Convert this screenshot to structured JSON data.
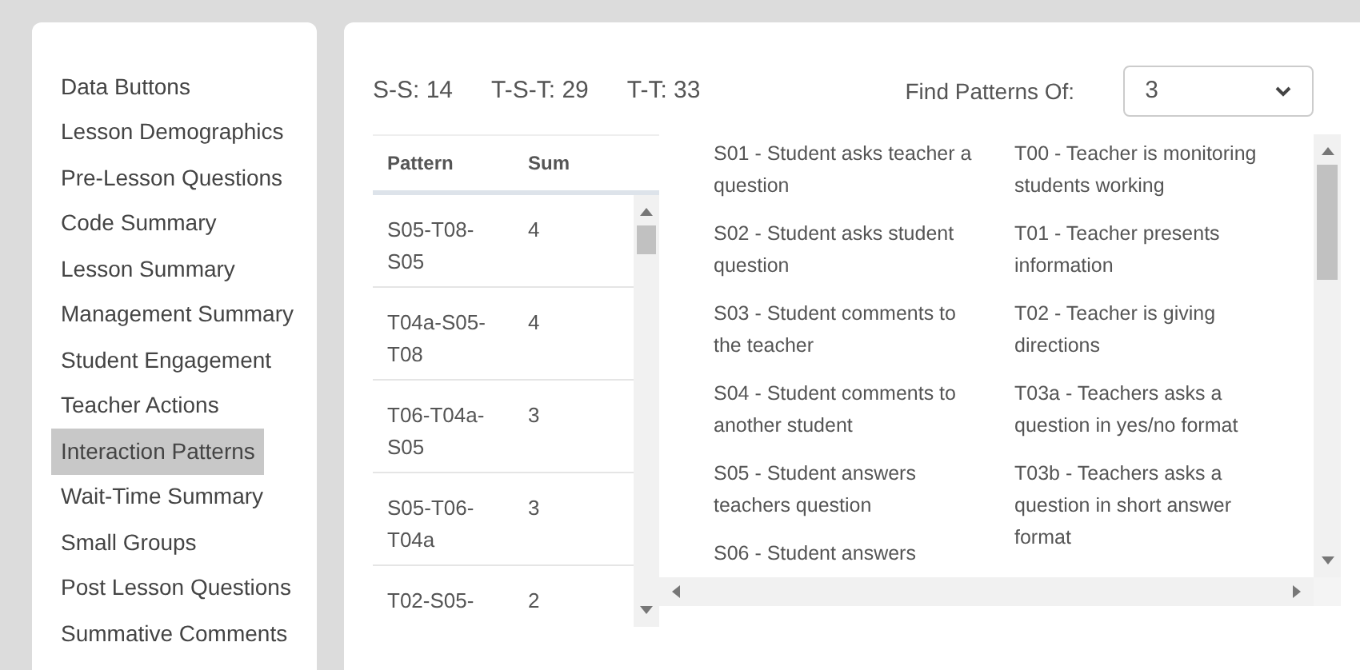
{
  "sidebar": {
    "items": [
      {
        "label": "Data Buttons",
        "selected": false
      },
      {
        "label": "Lesson Demographics",
        "selected": false
      },
      {
        "label": "Pre-Lesson Questions",
        "selected": false
      },
      {
        "label": "Code Summary",
        "selected": false
      },
      {
        "label": "Lesson Summary",
        "selected": false
      },
      {
        "label": "Management Summary",
        "selected": false
      },
      {
        "label": "Student Engagement",
        "selected": false
      },
      {
        "label": "Teacher Actions",
        "selected": false
      },
      {
        "label": "Interaction Patterns",
        "selected": true
      },
      {
        "label": "Wait-Time Summary",
        "selected": false
      },
      {
        "label": "Small Groups",
        "selected": false
      },
      {
        "label": "Post Lesson Questions",
        "selected": false
      },
      {
        "label": "Summative Comments",
        "selected": false
      }
    ]
  },
  "counts": [
    "S-S: 14",
    "T-S-T: 29",
    "T-T: 33"
  ],
  "find_patterns": {
    "label": "Find Patterns Of:",
    "value": "3"
  },
  "table": {
    "columns": [
      "Pattern",
      "Sum"
    ],
    "rows": [
      [
        "S05-T08-S05",
        "4"
      ],
      [
        "T04a-S05-T08",
        "4"
      ],
      [
        "T06-T04a-S05",
        "3"
      ],
      [
        "S05-T06-T04a",
        "3"
      ],
      [
        "T02-S05-",
        "2"
      ]
    ]
  },
  "legend": {
    "column_1": [
      "S01 - Student asks teacher a question",
      "S02 - Student asks student question",
      "S03 - Student comments to the teacher",
      "S04 - Student comments to another student",
      "S05 - Student answers teachers question",
      "S06 - Student answers"
    ],
    "column_2": [
      "T00 - Teacher is monitoring students working",
      "T01 - Teacher presents information",
      "T02 - Teacher is giving directions",
      "T03a - Teachers asks a question in yes/no format",
      "T03b - Teachers asks a question in short answer format"
    ]
  }
}
